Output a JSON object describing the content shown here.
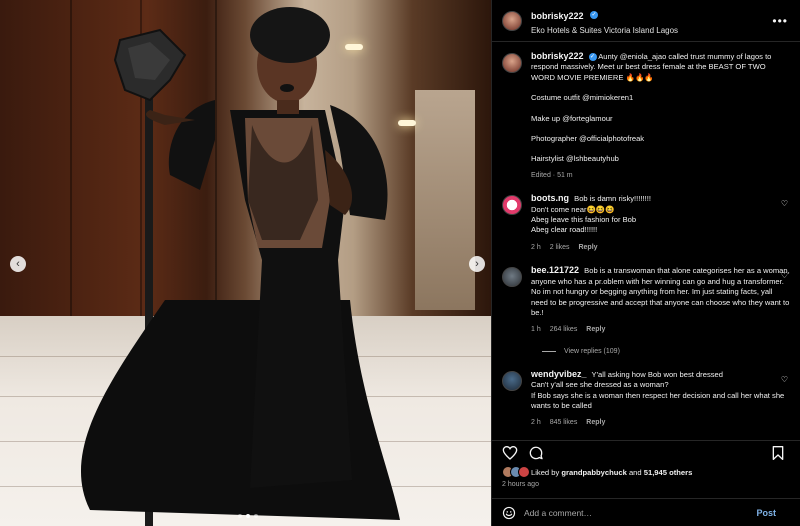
{
  "post": {
    "username": "bobrisky222",
    "location": "Eko Hotels & Suites Victoria Island Lagos",
    "more_icon": "ellipsis-icon",
    "caption": {
      "username": "bobrisky222",
      "lines": [
        "Aunty @eniola_ajao called trust mummy of lagos to respond massively. Meet ur best dress female at the BEAST OF TWO WORD MOVIE PREMIERE 🔥🔥🔥",
        "Costume outfit @mimiokeren1",
        "Make up @forteglamour",
        "Photographer @officialphotofreak",
        "Hairstylist @lshbeautyhub"
      ],
      "edited": "Edited · 51 m"
    }
  },
  "comments": [
    {
      "username": "boots.ng",
      "text_lines": [
        "Bob is damn risky!!!!!!!!",
        "Don't come near😆😆😆",
        "Abeg leave this fashion for Bob",
        "Abeg clear road!!!!!!"
      ],
      "time": "2 h",
      "likes": "2 likes",
      "reply": "Reply"
    },
    {
      "username": "bee.121722",
      "text_lines": [
        "Bob is a transwoman that alone categorises her as a woman, anyone who has a pr.oblem with her winning can go and hug a transformer. No im not hungry or begging anything from her. Im just stating facts, yall need to be progressive and accept that anyone can choose who they want to be.!"
      ],
      "time": "1 h",
      "likes": "264 likes",
      "reply": "Reply",
      "view_replies": "View replies (109)"
    },
    {
      "username": "wendyvibez_",
      "text_lines": [
        "Y'all asking how Bob won best dressed",
        "Can't y'all see she dressed as a woman?",
        "If Bob says she is a woman then respect her decision and call her what she wants to be called"
      ],
      "time": "2 h",
      "likes": "845 likes",
      "reply": "Reply"
    }
  ],
  "likes": {
    "prefix": "Liked by ",
    "user": "grandpabbychuck",
    "mid": " and ",
    "count": "51,945 others"
  },
  "time_ago": "2 hours ago",
  "comment_input": {
    "placeholder": "Add a comment…",
    "value": ""
  },
  "post_button": "Post",
  "carousel": {
    "prev_icon": "chevron-left-icon",
    "next_icon": "chevron-right-icon",
    "slide_count": 3,
    "active_slide": 2
  },
  "colors": {
    "background": "#000000",
    "text": "#f5f5f5",
    "muted": "#a8a8a8",
    "verified": "#3897f0",
    "post_button": "#7fb3e8",
    "divider": "#262626"
  }
}
